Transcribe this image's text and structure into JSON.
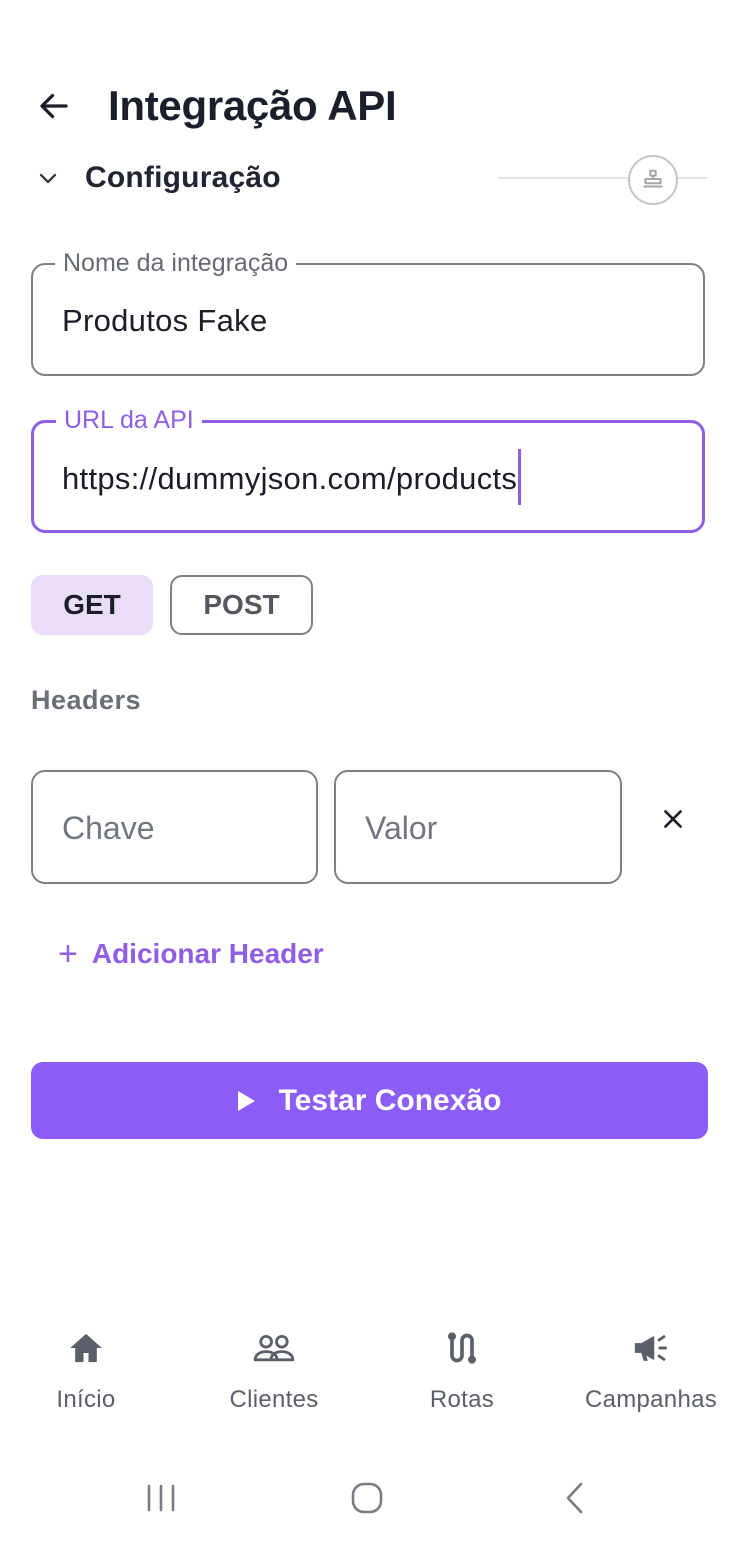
{
  "header": {
    "title": "Integração API"
  },
  "section": {
    "title": "Configuração"
  },
  "fields": {
    "name": {
      "label": "Nome da integração",
      "value": "Produtos Fake"
    },
    "url": {
      "label": "URL da API",
      "value": "https://dummyjson.com/products"
    }
  },
  "methods": {
    "get": "GET",
    "post": "POST",
    "selected": "GET"
  },
  "headers": {
    "label": "Headers",
    "key_placeholder": "Chave",
    "value_placeholder": "Valor",
    "add_label": "Adicionar Header"
  },
  "actions": {
    "test_label": "Testar Conexão"
  },
  "nav": {
    "items": [
      {
        "label": "Início",
        "icon": "home-icon",
        "active": true
      },
      {
        "label": "Clientes",
        "icon": "users-icon"
      },
      {
        "label": "Rotas",
        "icon": "route-icon"
      },
      {
        "label": "Campanhas",
        "icon": "megaphone-icon"
      }
    ]
  },
  "colors": {
    "accent": "#8b5cf6",
    "accent_light": "#e9ddf8",
    "text_primary": "#1b1d28",
    "text_muted": "#6a6e76"
  }
}
